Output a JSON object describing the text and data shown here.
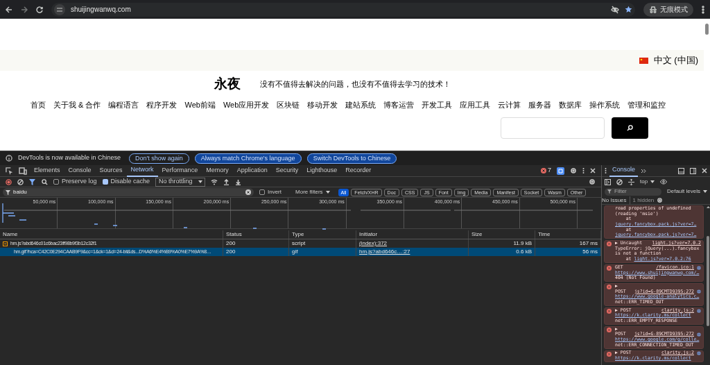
{
  "browser": {
    "url": "shuijingwanwq.com",
    "incognito_label": "无痕模式"
  },
  "page": {
    "language": "中文 (中国)",
    "site_title": "永夜",
    "tagline": "没有不值得去解决的问题，也没有不值得去学习的技术！",
    "nav": [
      "首页",
      "关于我 & 合作",
      "编程语言",
      "程序开发",
      "Web前端",
      "Web应用开发",
      "区块链",
      "移动开发",
      "建站系统",
      "博客运营",
      "开发工具",
      "应用工具",
      "云计算",
      "服务器",
      "数据库",
      "操作系统",
      "管理和监控"
    ]
  },
  "devtools": {
    "infobar": {
      "message": "DevTools is now available in Chinese",
      "buttons": [
        "Don't show again",
        "Always match Chrome's language",
        "Switch DevTools to Chinese"
      ]
    },
    "tabs": [
      {
        "label": "Elements",
        "selected": false
      },
      {
        "label": "Console",
        "selected": false
      },
      {
        "label": "Sources",
        "selected": false
      },
      {
        "label": "Network",
        "selected": true
      },
      {
        "label": "Performance",
        "selected": false
      },
      {
        "label": "Memory",
        "selected": false
      },
      {
        "label": "Application",
        "selected": false
      },
      {
        "label": "Security",
        "selected": false
      },
      {
        "label": "Lighthouse",
        "selected": false
      },
      {
        "label": "Recorder",
        "selected": false
      }
    ],
    "error_count": "7",
    "toolbar": {
      "preserve_log": {
        "label": "Preserve log",
        "checked": false
      },
      "disable_cache": {
        "label": "Disable cache",
        "checked": true
      },
      "throttling": "No throttling"
    },
    "filter": {
      "value": "baidu",
      "invert": {
        "label": "Invert",
        "checked": false
      },
      "more_filters": "More filters",
      "types": [
        {
          "label": "All",
          "selected": true
        },
        {
          "label": "Fetch/XHR",
          "selected": false
        },
        {
          "label": "Doc",
          "selected": false
        },
        {
          "label": "CSS",
          "selected": false
        },
        {
          "label": "JS",
          "selected": false
        },
        {
          "label": "Font",
          "selected": false
        },
        {
          "label": "Img",
          "selected": false
        },
        {
          "label": "Media",
          "selected": false
        },
        {
          "label": "Manifest",
          "selected": false
        },
        {
          "label": "Socket",
          "selected": false
        },
        {
          "label": "Wasm",
          "selected": false
        },
        {
          "label": "Other",
          "selected": false
        }
      ]
    },
    "timeline_ticks": [
      "50,000 ms",
      "100,000 ms",
      "150,000 ms",
      "200,000 ms",
      "250,000 ms",
      "300,000 ms",
      "350,000 ms",
      "400,000 ms",
      "450,000 ms",
      "500,000 ms"
    ],
    "table": {
      "columns": [
        "Name",
        "Status",
        "Type",
        "Initiator",
        "Size",
        "Time"
      ],
      "rows": [
        {
          "name": "hm.js?abd646c01c6bac23ff98b9f3b12c32f1",
          "status": "200",
          "type": "script",
          "initiator": "(index):372",
          "size": "11.9 kB",
          "time": "167 ms",
          "selected": false,
          "kind": "script"
        },
        {
          "name": "hm.gif?hca=C42C0E294CAAB9F9&cc=1&ck=1&cl=24-bit&ds...D%A6%E4%B9%A0%E7%9A%8…",
          "status": "200",
          "type": "gif",
          "initiator": "hm.js?abd646c…:27",
          "size": "0.6 kB",
          "time": "56 ms",
          "selected": true,
          "kind": "child"
        }
      ]
    },
    "console": {
      "tab": "Console",
      "context": "top",
      "filter_placeholder": "Filter",
      "levels": "Default levels",
      "issues": "No Issues",
      "hidden": "1 hidden",
      "messages": [
        {
          "icon": false,
          "lines": [
            {
              "text": "read properties of undefined"
            },
            {
              "text": "(reading 'msie')"
            },
            {
              "text": "    at"
            },
            {
              "text": "jquery.fancybox.pack.js?ver=7…",
              "link": true
            },
            {
              "text": "    at"
            },
            {
              "text": "jquery.fancybox.pack.js?ver=7…",
              "link": true
            }
          ]
        },
        {
          "icon": true,
          "lines": [
            {
              "text": "▶ Uncaught",
              "source": "light.js?ver=7.0.2"
            },
            {
              "text": "TypeError: jQuery(...).fancybox"
            },
            {
              "text": "is not a function"
            },
            {
              "prefix": "    at",
              "text": "light.js?ver=7.0.2:76",
              "link": true
            }
          ]
        },
        {
          "icon": true,
          "lines": [
            {
              "text": "GET",
              "source": "/favicon.ico:1",
              "globe": true
            },
            {
              "text": "https://www.shuijingwanwq.com/…",
              "link": true
            },
            {
              "text": "404 (Not Found)"
            }
          ]
        },
        {
          "icon": true,
          "lines": [
            {
              "text": "▶"
            },
            {
              "text": "POST",
              "source": "js?id=G-89CMTD9395:272",
              "globe": true
            },
            {
              "text": "https://www.google-analytics.c…",
              "link": true
            },
            {
              "text": "net::ERR_TIMED_OUT"
            }
          ]
        },
        {
          "icon": true,
          "lines": [
            {
              "text": "▶ POST",
              "source": "clarity.js:2",
              "globe": true
            },
            {
              "text": "https://k.clarity.ms/collect",
              "link": true
            },
            {
              "text": "net::ERR_EMPTY_RESPONSE"
            }
          ]
        },
        {
          "icon": true,
          "lines": [
            {
              "text": "▶"
            },
            {
              "text": "POST",
              "source": "js?id=G-89CMTD9395:272",
              "globe": true
            },
            {
              "text": "https://www.google.com/g/colle…",
              "link": true
            },
            {
              "text": "net::ERR_CONNECTION_TIMED_OUT"
            }
          ]
        },
        {
          "icon": true,
          "lines": [
            {
              "text": "▶ POST",
              "source": "clarity.js:2",
              "globe": true
            },
            {
              "text": "https://k.clarity.ms/collect",
              "link": true
            }
          ]
        }
      ]
    }
  }
}
